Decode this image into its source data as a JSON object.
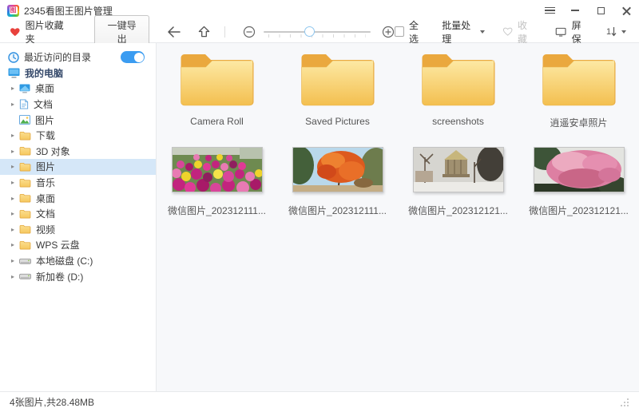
{
  "window": {
    "title": "2345看图王图片管理"
  },
  "icons": {
    "app_glyph": "图"
  },
  "toolbar": {
    "favorites_label": "图片收藏夹",
    "export_button": "一键导出",
    "select_all_label": "全选",
    "batch_label": "批量处理",
    "collect_label": "收藏",
    "screensaver_label": "屏保",
    "accent_red": "#e8413c",
    "accent_blue": "#3b9cf1"
  },
  "sidebar": {
    "recent_label": "最近访问的目录",
    "recent_toggle": "on",
    "computer_label": "我的电脑",
    "items": [
      {
        "label": "桌面",
        "icon": "desktop"
      },
      {
        "label": "文档",
        "icon": "document"
      },
      {
        "label": "图片",
        "icon": "picture"
      },
      {
        "label": "下载",
        "icon": "folder"
      },
      {
        "label": "3D 对象",
        "icon": "folder"
      },
      {
        "label": "图片",
        "icon": "folder",
        "selected": true
      },
      {
        "label": "音乐",
        "icon": "folder"
      },
      {
        "label": "桌面",
        "icon": "folder"
      },
      {
        "label": "文档",
        "icon": "folder"
      },
      {
        "label": "视频",
        "icon": "folder"
      },
      {
        "label": "WPS 云盘",
        "icon": "folder"
      },
      {
        "label": "本地磁盘 (C:)",
        "icon": "drive"
      },
      {
        "label": "新加卷 (D:)",
        "icon": "drive"
      }
    ]
  },
  "content": {
    "folders": [
      {
        "label": "Camera Roll"
      },
      {
        "label": "Saved Pictures"
      },
      {
        "label": "screenshots"
      },
      {
        "label": "逍遥安卓照片"
      }
    ],
    "images": [
      {
        "label": "微信图片_202312111...",
        "subject": "flower-beds"
      },
      {
        "label": "微信图片_202312111...",
        "subject": "autumn-maple"
      },
      {
        "label": "微信图片_202312121...",
        "subject": "snow-carousel"
      },
      {
        "label": "微信图片_202312121...",
        "subject": "pink-blossoms"
      }
    ]
  },
  "statusbar": {
    "text": "4张图片,共28.48MB"
  }
}
